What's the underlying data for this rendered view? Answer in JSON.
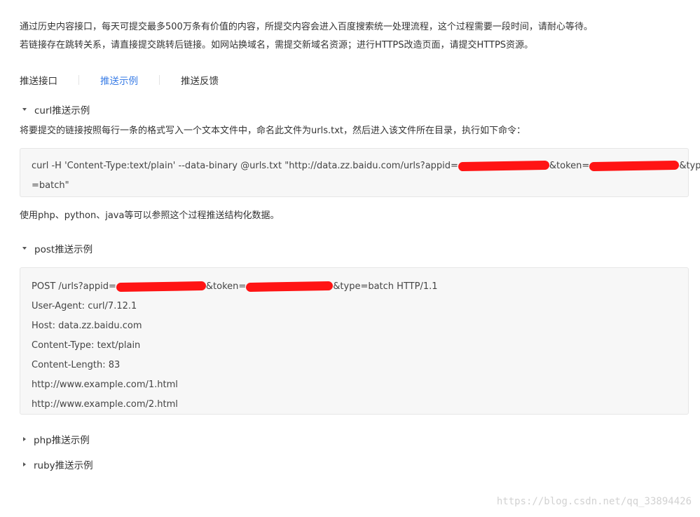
{
  "intro": {
    "line1": "通过历史内容接口，每天可提交最多500万条有价值的内容，所提交内容会进入百度搜索统一处理流程，这个过程需要一段时间，请耐心等待。",
    "line2": "若链接存在跳转关系，请直接提交跳转后链接。如网站换域名，需提交新域名资源；进行HTTPS改造页面，请提交HTTPS资源。"
  },
  "tabs": [
    {
      "label": "推送接口",
      "active": false
    },
    {
      "label": "推送示例",
      "active": true
    },
    {
      "label": "推送反馈",
      "active": false
    }
  ],
  "curl_section": {
    "title": "curl推送示例",
    "description": "将要提交的链接按照每行一条的格式写入一个文本文件中，命名此文件为urls.txt，然后进入该文件所在目录，执行如下命令：",
    "code_part1": "curl -H 'Content-Type:text/plain' --data-binary @urls.txt \"http://data.zz.baidu.com/urls?appid=",
    "code_token": "&token=",
    "code_type": "&type",
    "code_line2": "=batch\"",
    "note": "使用php、python、java等可以参照这个过程推送结构化数据。"
  },
  "post_section": {
    "title": "post推送示例",
    "line1_a": "POST /urls?appid=",
    "line1_b": "&token=",
    "line1_c": "&type=batch HTTP/1.1",
    "lines": [
      "User-Agent: curl/7.12.1",
      "Host: data.zz.baidu.com",
      "Content-Type: text/plain",
      "Content-Length: 83",
      "http://www.example.com/1.html",
      "http://www.example.com/2.html"
    ]
  },
  "php_section": {
    "title": "php推送示例"
  },
  "ruby_section": {
    "title": "ruby推送示例"
  },
  "watermark": "https://blog.csdn.net/qq_33894426",
  "colors": {
    "accent": "#3a7de6",
    "redaction": "#ff1414",
    "code_bg": "#f7f7f7"
  }
}
